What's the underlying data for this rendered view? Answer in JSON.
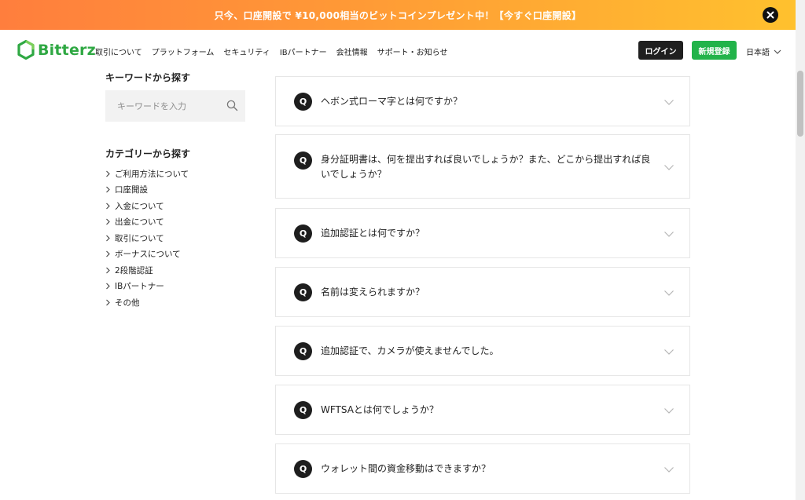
{
  "promo": {
    "text": "只今、口座開設で ¥10,000相当のビットコインプレゼント中！【今すぐ口座開設】"
  },
  "header": {
    "brand": "Bitterz",
    "nav": [
      "取引について",
      "プラットフォーム",
      "セキュリティ",
      "IBパートナー",
      "会社情報",
      "サポート・お知らせ"
    ],
    "login": "ログイン",
    "signup": "新規登録",
    "language": "日本語"
  },
  "sidebar": {
    "keyword_heading": "キーワードから探す",
    "search_placeholder": "キーワードを入力",
    "category_heading": "カテゴリーから探す",
    "categories": [
      "ご利用方法について",
      "口座開設",
      "入金について",
      "出金について",
      "取引について",
      "ボーナスについて",
      "2段階認証",
      "IBパートナー",
      "その他"
    ]
  },
  "faq": {
    "badge": "Q",
    "items": [
      "ヘボン式ローマ字とは何ですか？",
      "身分証明書は、何を提出すれば良いでしょうか？また、どこから提出すれば良いでしょうか？",
      "追加認証とは何ですか？",
      "名前は変えられますか？",
      "追加認証で、カメラが使えませんでした。",
      "WFTSAとは何でしょうか？",
      "ウォレット間の資金移動はできますか？"
    ]
  },
  "colors": {
    "brand_green": "#2fa843",
    "signup_green": "#22b34a",
    "promo_orange": "#ff8a3a",
    "dark": "#1f1f1f"
  },
  "icons": {
    "close": "close-icon",
    "search": "search-icon",
    "chevron": "chevron-down-icon",
    "category": "chevron-right-icon"
  }
}
